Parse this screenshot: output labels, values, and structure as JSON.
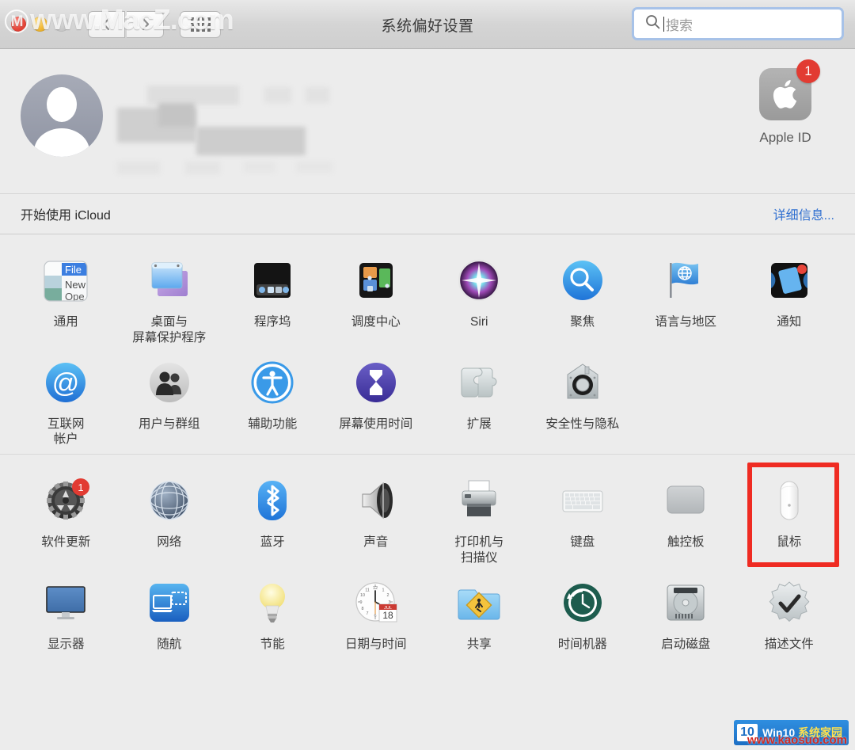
{
  "window": {
    "title": "系统偏好设置",
    "traffic_lights": [
      "close",
      "minimize",
      "zoom"
    ],
    "nav_back": "‹",
    "nav_forward": "›",
    "show_all": "show-all-grid",
    "watermark_top": "www.MacZ.com",
    "watermark_top_logo": "M"
  },
  "search": {
    "placeholder": "搜索",
    "value": "",
    "icon": "search-icon"
  },
  "apple_id": {
    "name_redacted": true,
    "icon_label": "Apple ID",
    "badge": "1",
    "avatar": "default-user-avatar"
  },
  "icloud": {
    "text": "开始使用 iCloud",
    "link": "详细信息..."
  },
  "sections": [
    {
      "name": "personal",
      "items": [
        {
          "label": "通用",
          "icon": "general-icon",
          "badge": null,
          "highlight": false
        },
        {
          "label": "桌面与\n屏幕保护程序",
          "icon": "desktop-screensaver-icon",
          "badge": null,
          "highlight": false
        },
        {
          "label": "程序坞",
          "icon": "dock-icon",
          "badge": null,
          "highlight": false
        },
        {
          "label": "调度中心",
          "icon": "mission-control-icon",
          "badge": null,
          "highlight": false
        },
        {
          "label": "Siri",
          "icon": "siri-icon",
          "badge": null,
          "highlight": false
        },
        {
          "label": "聚焦",
          "icon": "spotlight-icon",
          "badge": null,
          "highlight": false
        },
        {
          "label": "语言与地区",
          "icon": "language-region-icon",
          "badge": null,
          "highlight": false
        },
        {
          "label": "通知",
          "icon": "notifications-icon",
          "badge": null,
          "highlight": false
        },
        {
          "label": "互联网\n帐户",
          "icon": "internet-accounts-icon",
          "badge": null,
          "highlight": false
        },
        {
          "label": "用户与群组",
          "icon": "users-groups-icon",
          "badge": null,
          "highlight": false
        },
        {
          "label": "辅助功能",
          "icon": "accessibility-icon",
          "badge": null,
          "highlight": false
        },
        {
          "label": "屏幕使用时间",
          "icon": "screen-time-icon",
          "badge": null,
          "highlight": false
        },
        {
          "label": "扩展",
          "icon": "extensions-icon",
          "badge": null,
          "highlight": false
        },
        {
          "label": "安全性与隐私",
          "icon": "security-privacy-icon",
          "badge": null,
          "highlight": false
        }
      ]
    },
    {
      "name": "hardware",
      "items": [
        {
          "label": "软件更新",
          "icon": "software-update-icon",
          "badge": "1",
          "highlight": false
        },
        {
          "label": "网络",
          "icon": "network-icon",
          "badge": null,
          "highlight": false
        },
        {
          "label": "蓝牙",
          "icon": "bluetooth-icon",
          "badge": null,
          "highlight": false
        },
        {
          "label": "声音",
          "icon": "sound-icon",
          "badge": null,
          "highlight": false
        },
        {
          "label": "打印机与\n扫描仪",
          "icon": "printers-scanners-icon",
          "badge": null,
          "highlight": false
        },
        {
          "label": "键盘",
          "icon": "keyboard-icon",
          "badge": null,
          "highlight": false
        },
        {
          "label": "触控板",
          "icon": "trackpad-icon",
          "badge": null,
          "highlight": false
        },
        {
          "label": "鼠标",
          "icon": "mouse-icon",
          "badge": null,
          "highlight": true
        },
        {
          "label": "显示器",
          "icon": "displays-icon",
          "badge": null,
          "highlight": false
        },
        {
          "label": "随航",
          "icon": "sidecar-icon",
          "badge": null,
          "highlight": false
        },
        {
          "label": "节能",
          "icon": "energy-saver-icon",
          "badge": null,
          "highlight": false
        },
        {
          "label": "日期与时间",
          "icon": "date-time-icon",
          "badge": null,
          "highlight": false
        },
        {
          "label": "共享",
          "icon": "sharing-icon",
          "badge": null,
          "highlight": false
        },
        {
          "label": "时间机器",
          "icon": "time-machine-icon",
          "badge": null,
          "highlight": false
        },
        {
          "label": "启动磁盘",
          "icon": "startup-disk-icon",
          "badge": null,
          "highlight": false
        },
        {
          "label": "描述文件",
          "icon": "profiles-icon",
          "badge": null,
          "highlight": false
        }
      ]
    }
  ],
  "date_time_icon": {
    "month": "JUL",
    "day": "18"
  },
  "general_icon_text": {
    "line1": "File",
    "line2": "New",
    "line3": "Ope"
  },
  "watermark_bottom": {
    "logo": "10",
    "label_en": "Win",
    "label_num": "10",
    "label_cn": "系统家园",
    "url": "www.kaosuo.com"
  },
  "colors": {
    "accent_blue": "#2f6fd0",
    "badge_red": "#e23b32",
    "highlight_red": "#ef2b22",
    "window_bg": "#ececec"
  }
}
